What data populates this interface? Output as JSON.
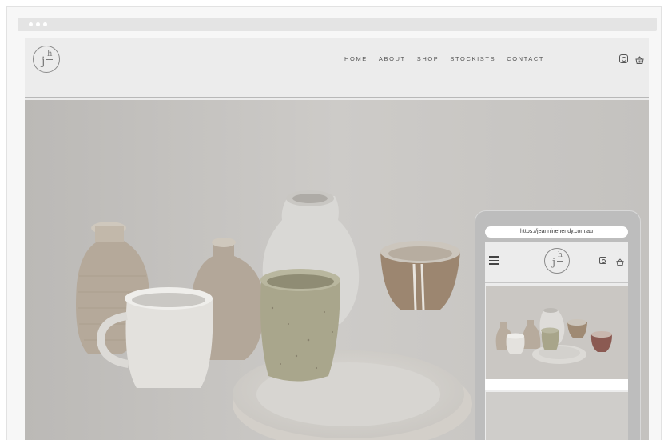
{
  "browser": {
    "window_controls": [
      "dot",
      "dot",
      "dot"
    ]
  },
  "site": {
    "logo": {
      "letters": "jh",
      "j": "j",
      "h": "h"
    },
    "nav": [
      "HOME",
      "ABOUT",
      "SHOP",
      "STOCKISTS",
      "CONTACT"
    ],
    "icons": [
      "instagram-icon",
      "basket-icon"
    ]
  },
  "mobile": {
    "url": "https://jeanninehendy.com.au",
    "logo": {
      "j": "j",
      "h": "h"
    },
    "icons": [
      "menu-icon",
      "instagram-icon",
      "basket-icon"
    ]
  },
  "colors": {
    "background": "#ececec",
    "text": "#555555",
    "accent_line": "#b8b8b8"
  }
}
